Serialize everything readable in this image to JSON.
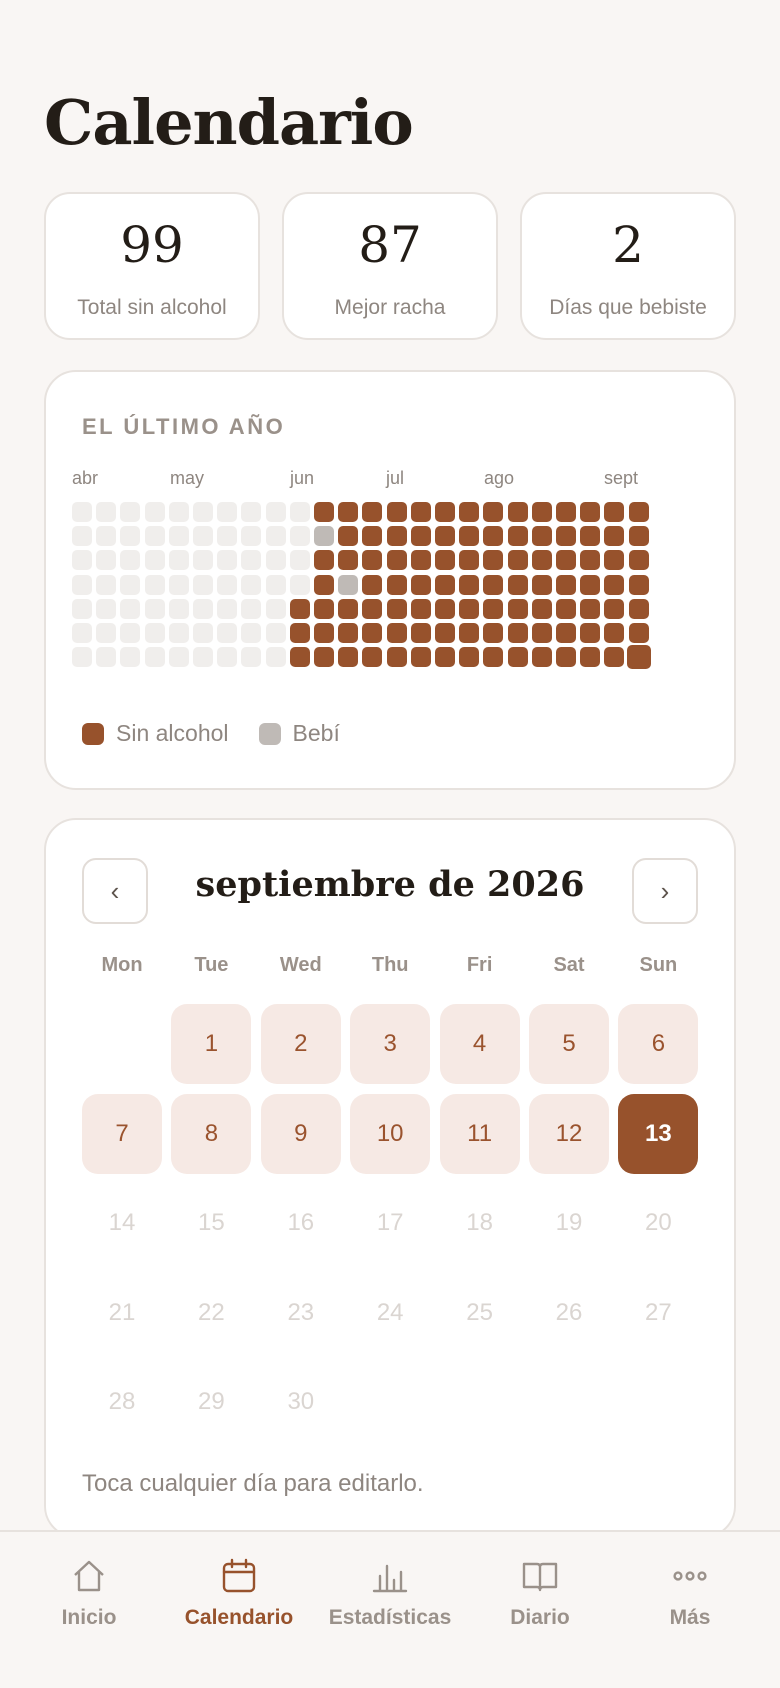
{
  "page": {
    "title": "Calendario"
  },
  "stats": [
    {
      "value": "99",
      "label": "Total sin alcohol"
    },
    {
      "value": "87",
      "label": "Mejor racha"
    },
    {
      "value": "2",
      "label": "Días que bebiste"
    }
  ],
  "year": {
    "title": "EL ÚLTIMO AÑO",
    "months": [
      "abr",
      "may",
      "jun",
      "jul",
      "ago",
      "sept"
    ],
    "columns": 24,
    "rows": 7,
    "first_sober_column": 10,
    "drank_days": [
      [
        10,
        1
      ],
      [
        11,
        3
      ]
    ],
    "last_day": [
      23,
      6
    ],
    "legend": {
      "sober": "Sin alcohol",
      "drank": "Bebí"
    }
  },
  "calendar": {
    "month_title": "septiembre de 2026",
    "prev": "‹",
    "next": "›",
    "weekdays": [
      "Mon",
      "Tue",
      "Wed",
      "Thu",
      "Fri",
      "Sat",
      "Sun"
    ],
    "first_weekday_index": 1,
    "days_in_month": 30,
    "today": 13,
    "hint": "Toca cualquier día para editarlo."
  },
  "nav": [
    {
      "label": "Inicio",
      "icon": "home-icon",
      "active": false
    },
    {
      "label": "Calendario",
      "icon": "calendar-icon",
      "active": true
    },
    {
      "label": "Estadísticas",
      "icon": "stats-icon",
      "active": false
    },
    {
      "label": "Diario",
      "icon": "journal-icon",
      "active": false
    },
    {
      "label": "Más",
      "icon": "more-icon",
      "active": false
    }
  ],
  "colors": {
    "accent": "#97522c",
    "drank": "#bfbab6",
    "empty": "#f0eeec",
    "day_bg": "#f6e9e4",
    "muted": "#9a918a"
  }
}
